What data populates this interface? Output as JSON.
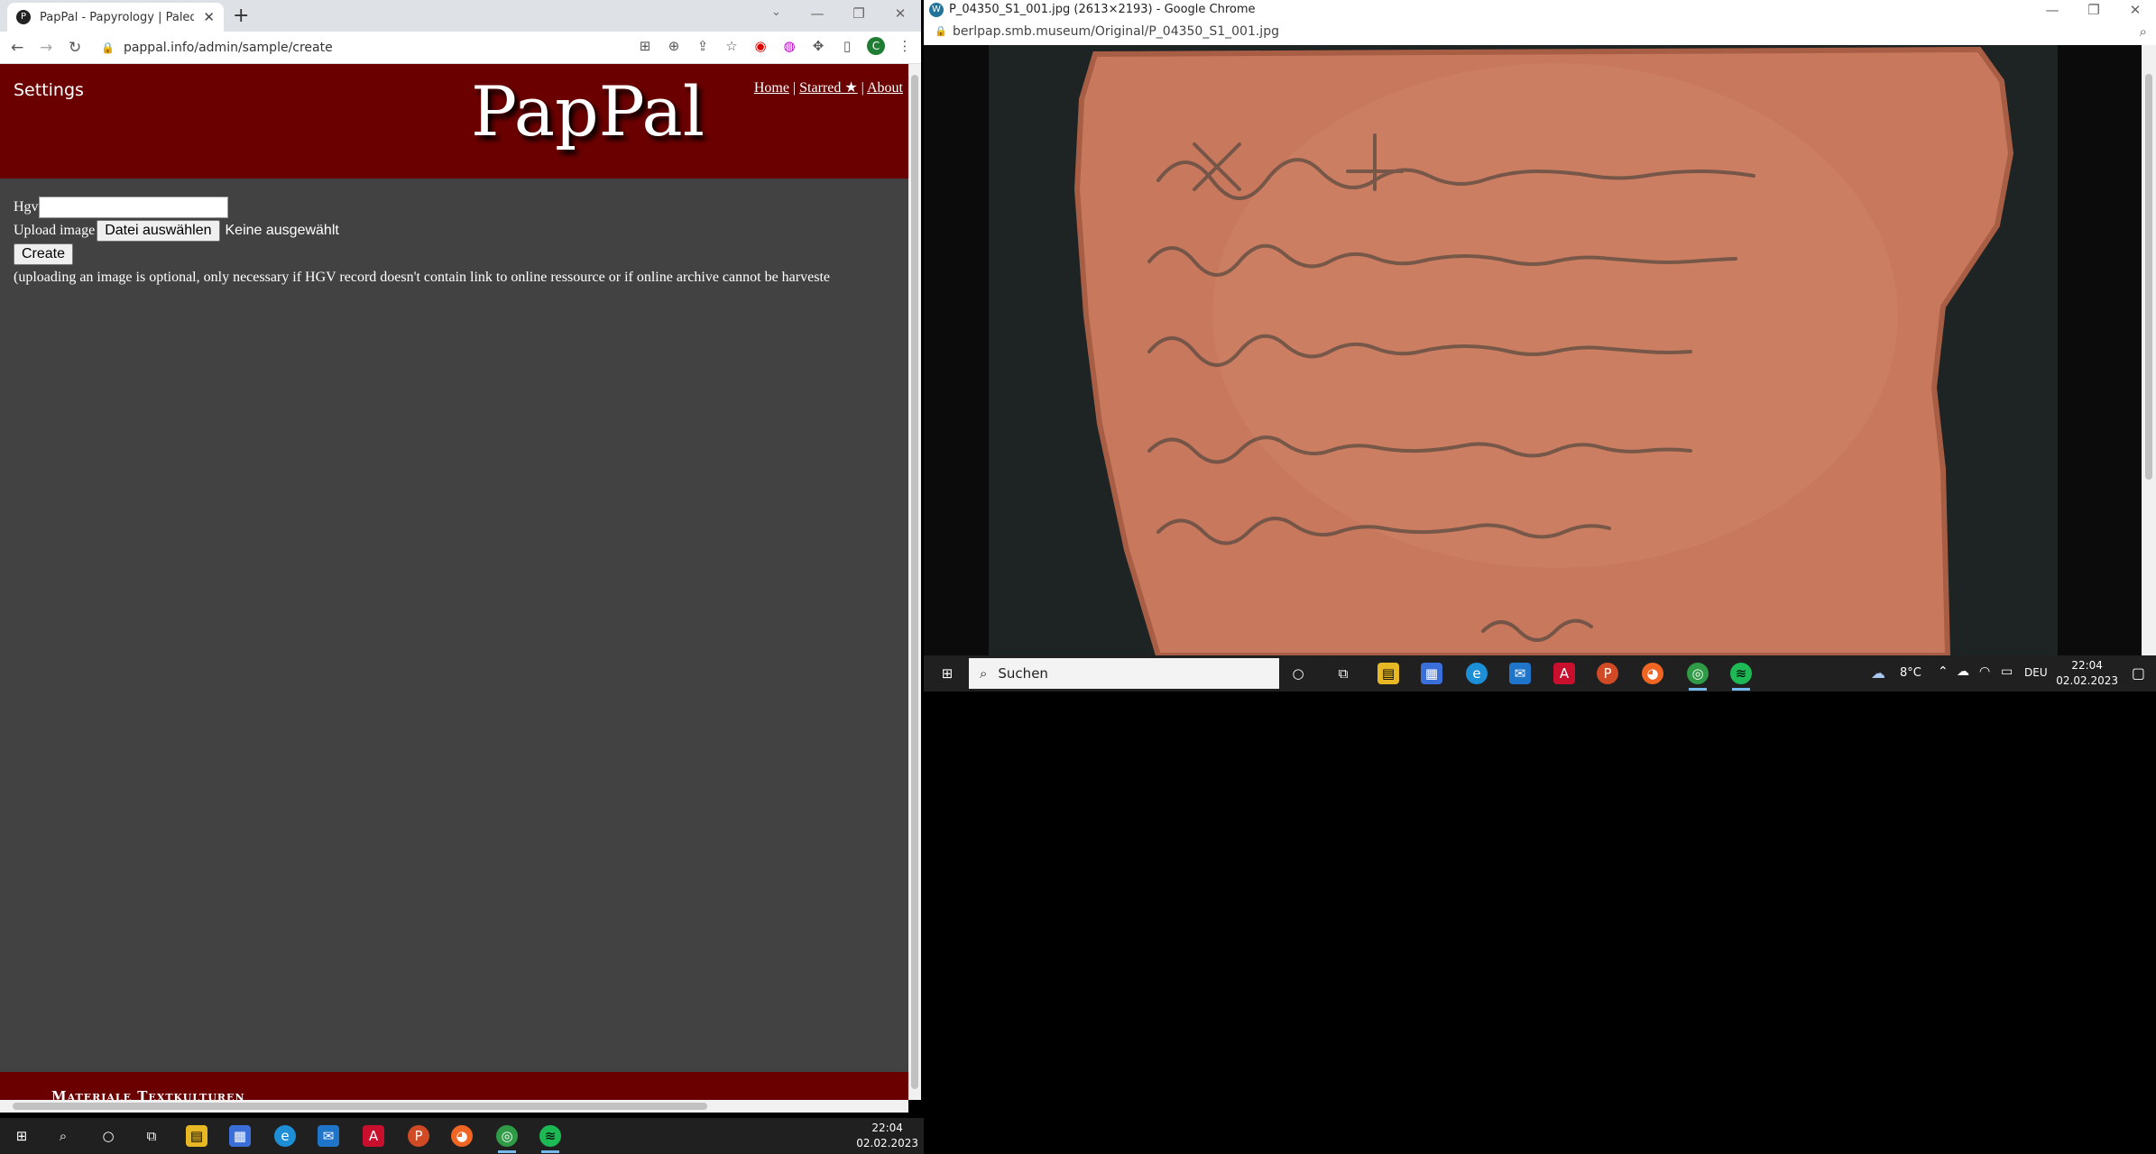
{
  "left_window": {
    "tab_title": "PapPal - Papyrology | Paleograph",
    "url": "pappal.info/admin/sample/create",
    "avatar_letter": "C",
    "site": {
      "settings_label": "Settings",
      "logo": "PapPal",
      "nav": {
        "home": "Home",
        "sep1": "|",
        "starred": "Starred ★",
        "sep2": "|",
        "about": "About"
      },
      "form": {
        "hgv_label": "Hgv",
        "hgv_value": "",
        "upload_label": "Upload image",
        "file_button": "Datei auswählen",
        "file_status": "Keine ausgewählt",
        "create_button": "Create",
        "note": "(uploading an image is optional, only necessary if HGV record doesn't contain link to online ressource or if online archive cannot be harveste"
      },
      "footer_text": "Materiale Textkulturen"
    }
  },
  "right_window": {
    "title": "P_04350_S1_001.jpg (2613×2193) - Google Chrome",
    "url": "berlpap.smb.museum/Original/P_04350_S1_001.jpg"
  },
  "taskbar_left": {
    "time": "22:04",
    "date": "02.02.2023"
  },
  "taskbar_right": {
    "search_placeholder": "Suchen",
    "weather": "8°C",
    "language": "DEU",
    "time": "22:04",
    "date": "02.02.2023"
  },
  "colors": {
    "header": "#6b0000",
    "page_bg": "#424242",
    "taskbar": "#202020"
  },
  "icons": [
    "windows-icon",
    "search-icon",
    "cortana-icon",
    "task-view-icon",
    "file-explorer-icon",
    "store-icon",
    "edge-icon",
    "mail-icon",
    "acrobat-icon",
    "powerpoint-icon",
    "firefox-icon",
    "chrome-icon",
    "spotify-icon"
  ]
}
